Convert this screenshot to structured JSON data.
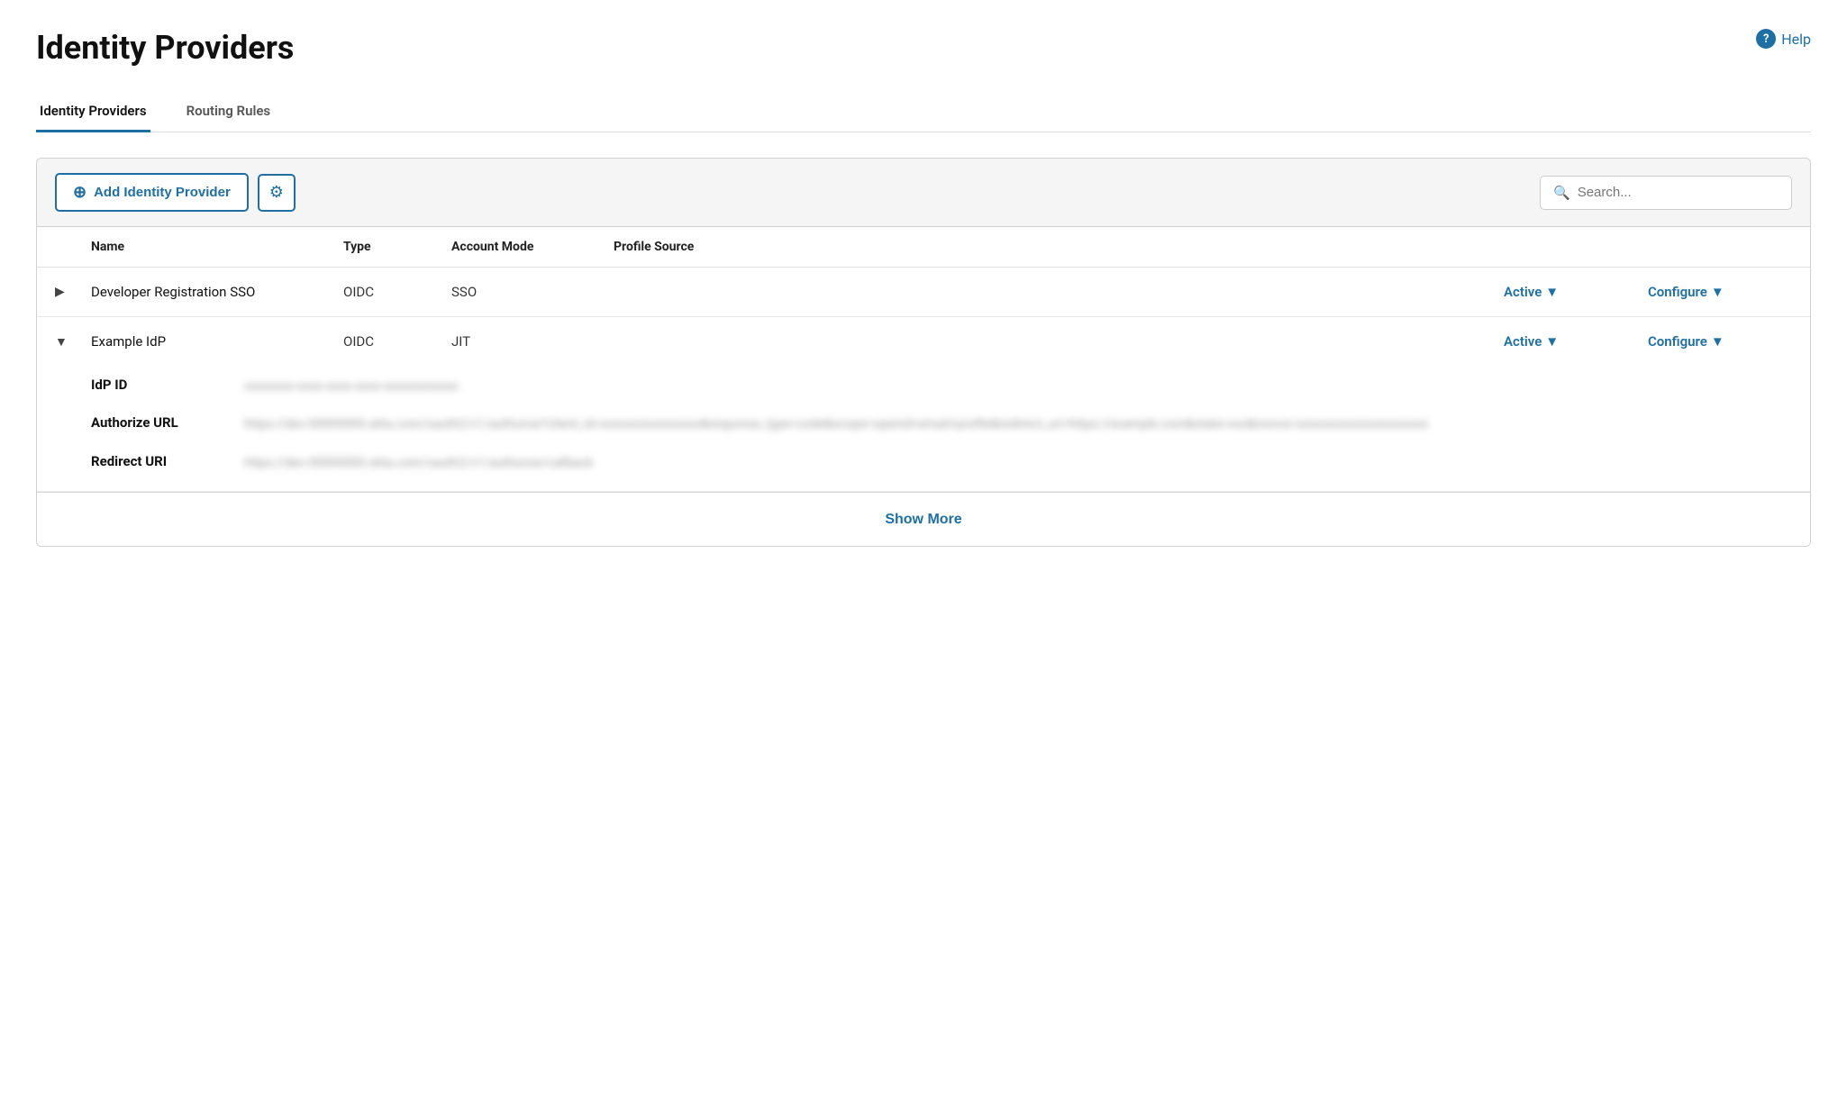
{
  "page": {
    "title": "Identity Providers",
    "help_label": "Help"
  },
  "tabs": [
    {
      "id": "identity-providers",
      "label": "Identity Providers",
      "active": true
    },
    {
      "id": "routing-rules",
      "label": "Routing Rules",
      "active": false
    }
  ],
  "toolbar": {
    "add_button_label": "Add Identity Provider",
    "search_placeholder": "Search..."
  },
  "table": {
    "headers": [
      "",
      "Name",
      "Type",
      "Account Mode",
      "Profile Source",
      "",
      ""
    ],
    "providers": [
      {
        "id": "dev-reg-sso",
        "name": "Developer Registration SSO",
        "type": "OIDC",
        "account_mode": "SSO",
        "profile_source": "",
        "status": "Active",
        "configure_label": "Configure",
        "expanded": false
      },
      {
        "id": "example-idp",
        "name": "Example IdP",
        "type": "OIDC",
        "account_mode": "JIT",
        "profile_source": "",
        "status": "Active",
        "configure_label": "Configure",
        "expanded": true,
        "details": {
          "idp_id_label": "IdP ID",
          "idp_id_value": "xxxxxxxx-xxxx-xxxx-xxxx-xxxxxxxxxxxx",
          "authorize_url_label": "Authorize URL",
          "authorize_url_value": "https://dev-00000000.okta.com/oauth2/v1/authorize?client_id=xxxxxxxxxxxxxxxx&response_type=code&scope=openid+email+profile&redirect_uri=https://example.com&state=xxx&nonce=xxxxxxxxxxxxxxxxxxxxx",
          "redirect_uri_label": "Redirect URI",
          "redirect_uri_value": "https://dev-00000000.okta.com/oauth2/v1/authorize/callback"
        }
      }
    ],
    "show_more_label": "Show More"
  }
}
